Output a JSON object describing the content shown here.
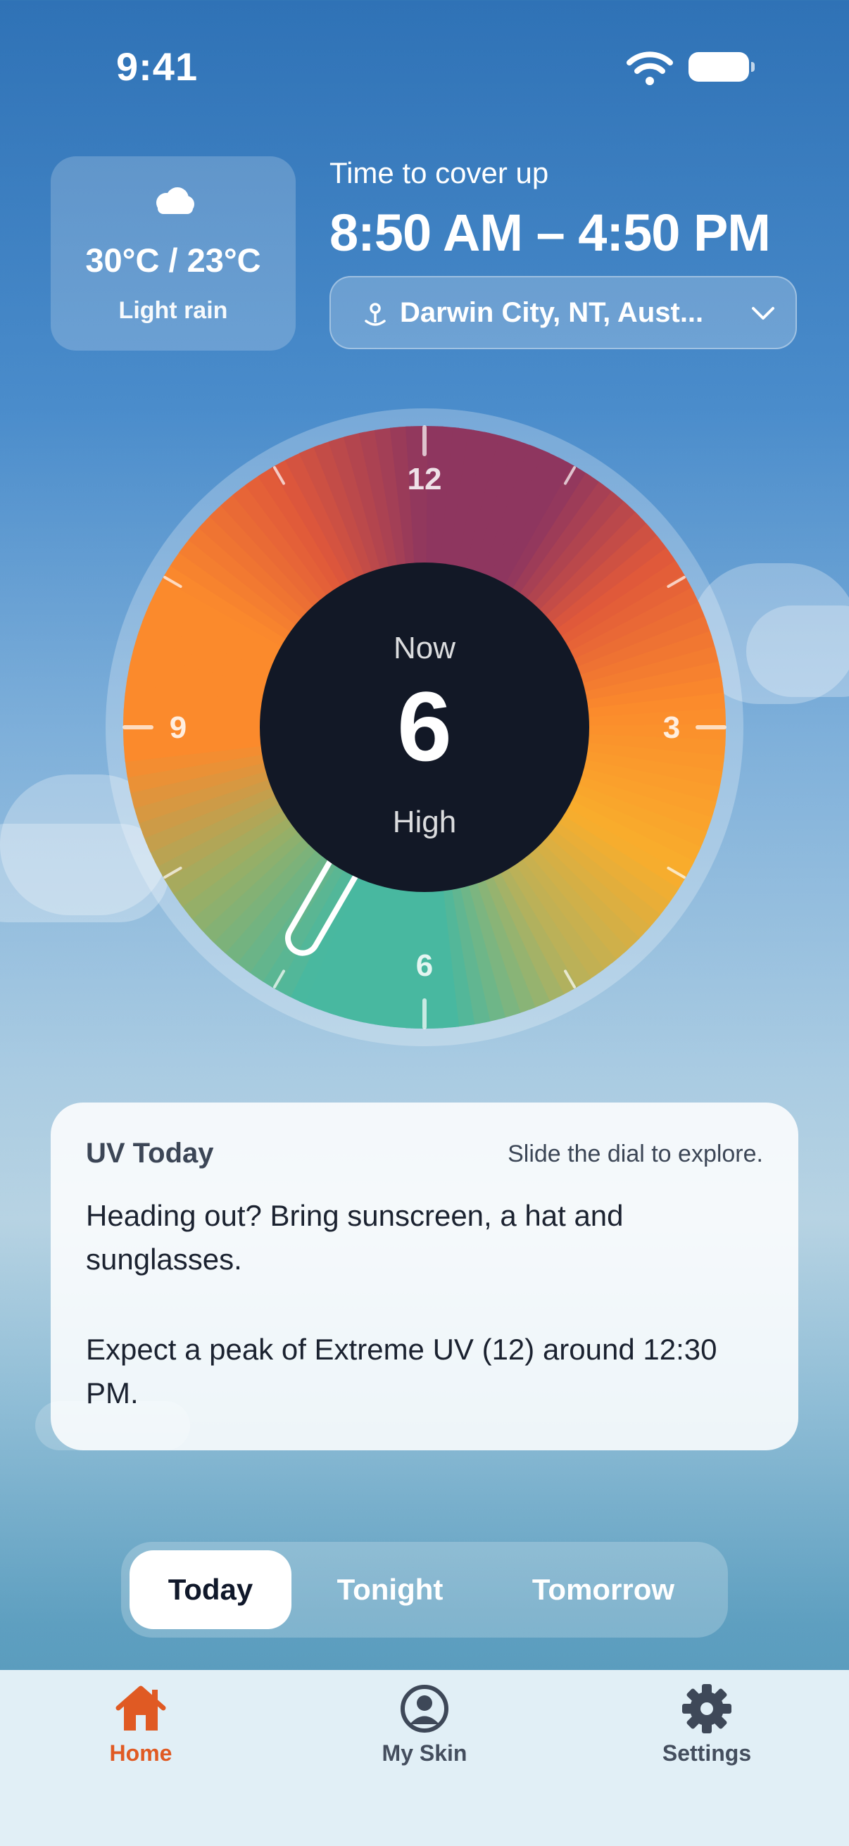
{
  "status_bar": {
    "time": "9:41"
  },
  "weather": {
    "temperature": "30°C / 23°C",
    "condition": "Light rain",
    "icon": "cloud-icon"
  },
  "cover_up": {
    "label": "Time to cover up",
    "range": "8:50 AM – 4:50 PM"
  },
  "location": {
    "name": "Darwin City, NT, Aust..."
  },
  "dial": {
    "now_label": "Now",
    "uv_value": "6",
    "uv_level": "High",
    "hour_labels": {
      "12": "12",
      "3": "3",
      "6": "6",
      "9": "9"
    },
    "colors": {
      "extreme": "#8e365f",
      "very_high": "#e0583a",
      "high": "#fb8a2c",
      "moderate": "#f9ad2c",
      "low": "#48b8a0",
      "center": "#121826"
    }
  },
  "uv_card": {
    "title": "UV Today",
    "hint": "Slide the dial to explore.",
    "message_1": "Heading out? Bring sunscreen, a hat and sunglasses.",
    "message_2": "Expect a peak of Extreme UV (12) around 12:30 PM."
  },
  "segments": {
    "today": "Today",
    "tonight": "Tonight",
    "tomorrow": "Tomorrow",
    "selected": "Today"
  },
  "tabs": {
    "home": "Home",
    "my_skin": "My Skin",
    "settings": "Settings",
    "active": "Home",
    "active_color": "#e05a23"
  }
}
